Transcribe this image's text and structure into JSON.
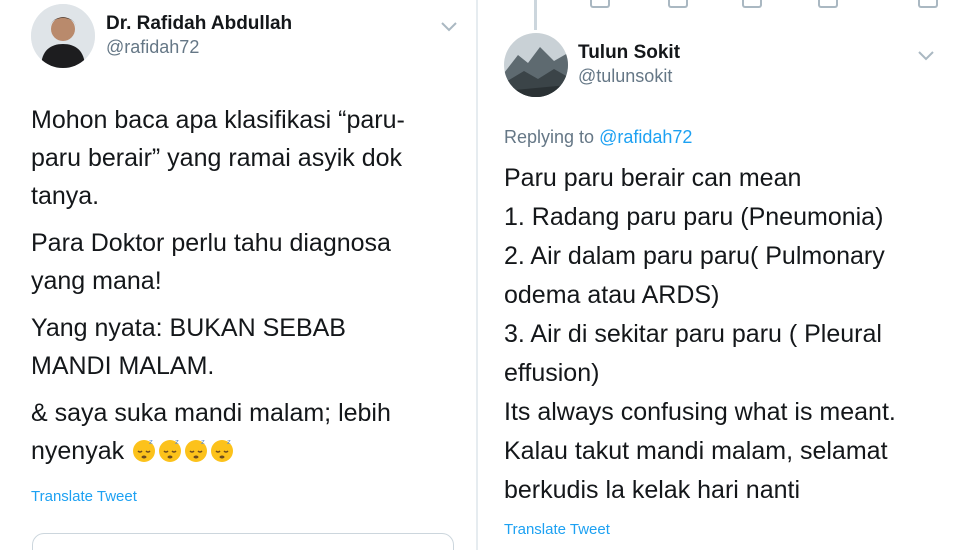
{
  "left_tweet": {
    "author_name": "Dr. Rafidah Abdullah",
    "author_handle": "@rafidah72",
    "paragraphs": [
      "Mohon baca apa klasifikasi “paru-paru berair” yang ramai asyik dok tanya.",
      "Para Doktor perlu tahu diagnosa yang mana!",
      "Yang nyata: BUKAN SEBAB MANDI MALAM.",
      "& saya suka mandi malam; lebih nyenyak"
    ],
    "translate_label": "Translate Tweet",
    "emojis": [
      "sleeping-face",
      "sleeping-face",
      "sleeping-face",
      "sleeping-face"
    ]
  },
  "right_tweet": {
    "author_name": "Tulun Sokit",
    "author_handle": "@tulunsokit",
    "replying_prefix": "Replying to",
    "replying_to": "@rafidah72",
    "lines": [
      "Paru paru berair can mean",
      "1. Radang paru paru (Pneumonia)",
      "2. Air dalam paru paru( Pulmonary",
      "odema atau ARDS)",
      "3. Air di sekitar paru paru ( Pleural",
      "effusion)",
      "Its always confusing what is meant.",
      "Kalau takut mandi malam, selamat",
      "berkudis la kelak hari nanti"
    ],
    "translate_label": "Translate Tweet"
  },
  "colors": {
    "link": "#1da1f2",
    "secondary_text": "#657786",
    "primary_text": "#14171a",
    "border": "#e6ecf0"
  }
}
